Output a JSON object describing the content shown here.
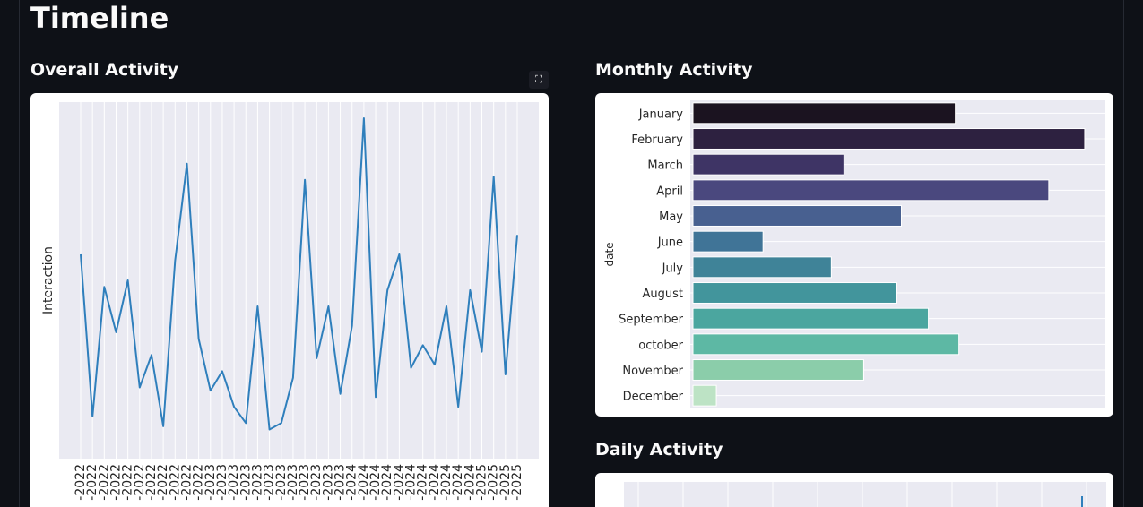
{
  "page": {
    "title": "Timeline"
  },
  "sections": {
    "overall": "Overall Activity",
    "monthly": "Monthly Activity",
    "daily": "Daily Activity"
  },
  "fullscreen_icon": "⛶",
  "chart_data": [
    {
      "id": "overall",
      "type": "line",
      "title": "Overall Activity",
      "ylabel": "Interaction",
      "xlabel": "",
      "x": [
        "-2022",
        "-2022",
        "-2022",
        "-2022",
        "-2022",
        "-2022",
        "-2022",
        "-2022",
        "-2022",
        "-2022",
        "-2022",
        "-2023",
        "-2023",
        "-2023",
        "-2023",
        "-2023",
        "-2023",
        "-2023",
        "-2023",
        "-2023",
        "-2023",
        "-2023",
        "-2023",
        "-2024",
        "-2024",
        "-2024",
        "-2024",
        "-2024",
        "-2024",
        "-2024",
        "-2024",
        "-2024",
        "-2024",
        "-2024",
        "-2025",
        "-2025",
        "-2025",
        "-2025"
      ],
      "values": [
        58,
        8,
        48,
        34,
        50,
        17,
        27,
        5,
        56,
        86,
        32,
        16,
        22,
        11,
        6,
        42,
        4,
        6,
        20,
        81,
        26,
        42,
        15,
        36,
        100,
        14,
        47,
        58,
        23,
        30,
        24,
        42,
        11,
        47,
        28,
        82,
        21,
        64
      ],
      "ylim": [
        0,
        100
      ],
      "grid": true,
      "color": "#2f7fbc"
    },
    {
      "id": "monthly",
      "type": "bar",
      "title": "Monthly Activity",
      "ylabel": "date",
      "categories": [
        "January",
        "February",
        "March",
        "April",
        "May",
        "June",
        "July",
        "August",
        "September",
        "october",
        "November",
        "December"
      ],
      "values": [
        295,
        439,
        171,
        399,
        235,
        81,
        157,
        230,
        265,
        299,
        193,
        29
      ],
      "xlim": [
        0,
        462
      ],
      "colors": [
        "#1b1320",
        "#2d2140",
        "#3e3465",
        "#4a487e",
        "#486090",
        "#407497",
        "#3f8398",
        "#42959c",
        "#4ba69f",
        "#5db8a4",
        "#8bcdaa",
        "#bde3c5"
      ],
      "grid": true
    },
    {
      "id": "daily",
      "type": "line",
      "title": "Daily Activity",
      "values": [],
      "grid": true
    }
  ]
}
